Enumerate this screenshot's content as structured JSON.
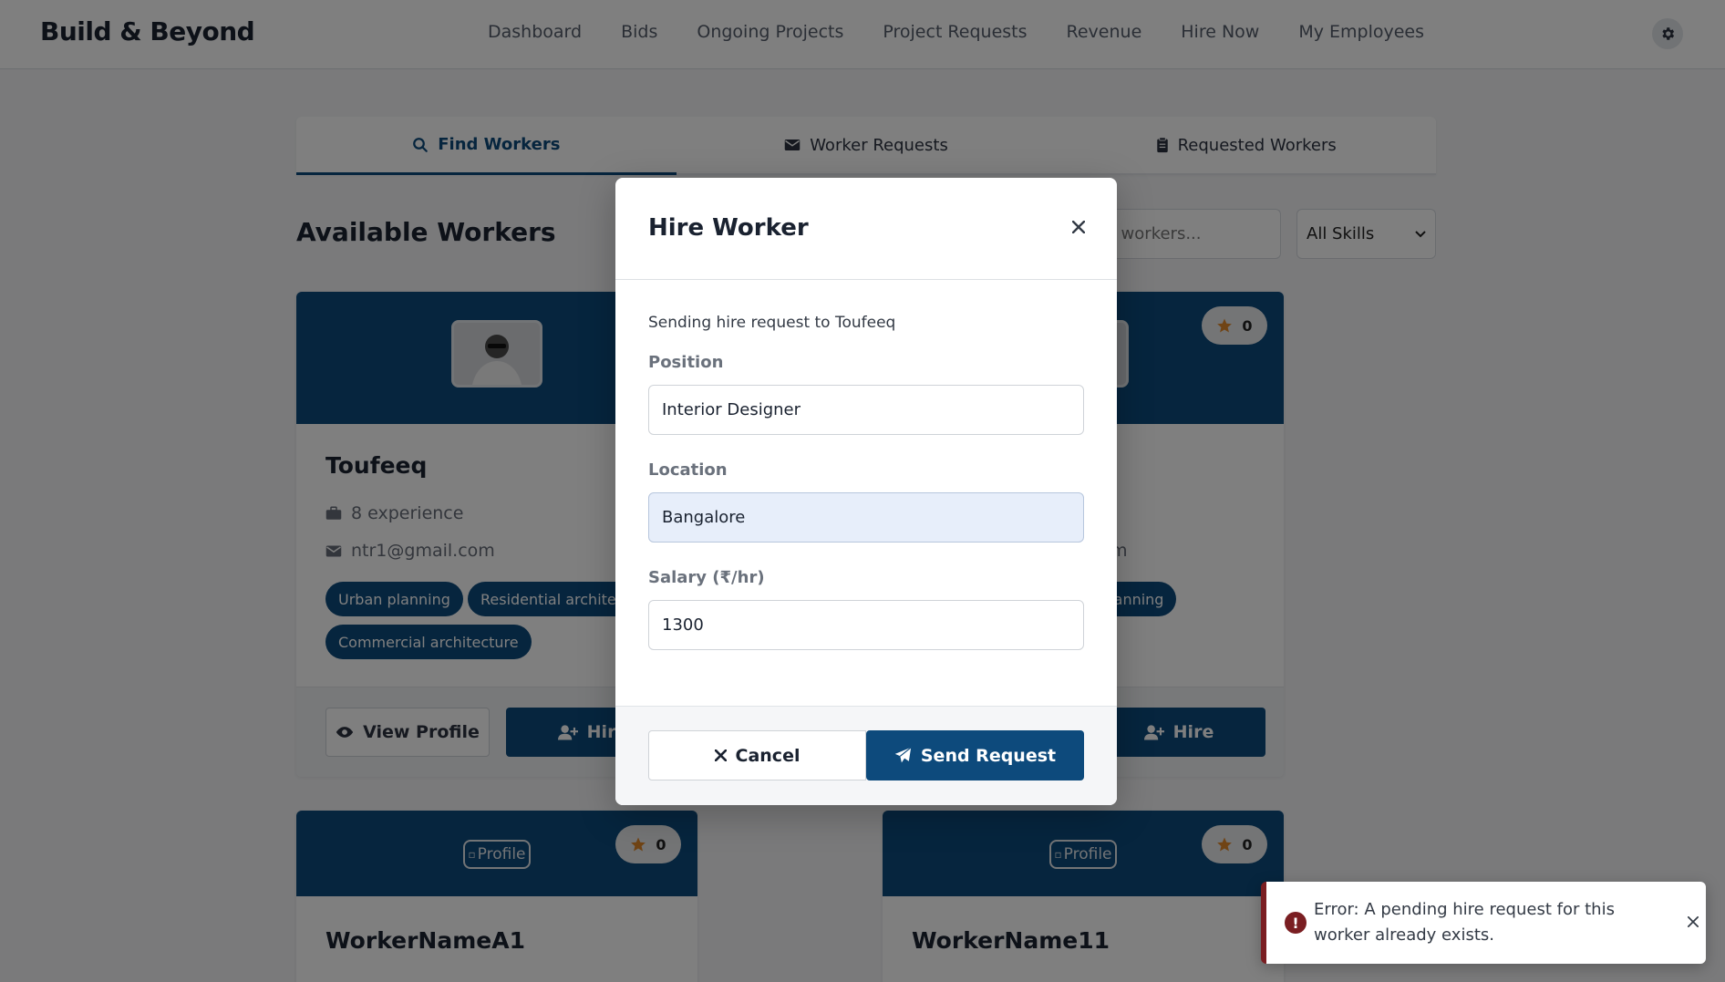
{
  "nav": {
    "brand": "Build & Beyond",
    "links": [
      "Dashboard",
      "Bids",
      "Ongoing Projects",
      "Project Requests",
      "Revenue",
      "Hire Now",
      "My Employees"
    ],
    "settings_icon": "gear-icon"
  },
  "tabs": [
    {
      "label": "Find Workers",
      "icon": "search-icon",
      "active": true
    },
    {
      "label": "Worker Requests",
      "icon": "envelope-icon",
      "active": false
    },
    {
      "label": "Requested Workers",
      "icon": "clipboard-icon",
      "active": false
    }
  ],
  "section": {
    "title": "Available Workers",
    "search_placeholder": "Search workers...",
    "skills_filter": "All Skills"
  },
  "cards": [
    {
      "name": "Toufeeq",
      "experience": "8 experience",
      "email": "ntr1@gmail.com",
      "skills": [
        "Urban planning",
        "Residential architecture",
        "Commercial architecture"
      ],
      "view_label": "View Profile",
      "hire_label": "Hire"
    },
    {
      "rating": "0",
      "email_tail": "m",
      "skill_tail": "an planning",
      "hire_label": "Hire"
    },
    {
      "name": "WorkerNameA1",
      "rating": "0",
      "img_alt": "Profile"
    },
    {
      "name": "WorkerName11",
      "rating": "0",
      "img_alt": "Profile"
    }
  ],
  "modal": {
    "title": "Hire Worker",
    "intro": "Sending hire request to Toufeeq",
    "position_label": "Position",
    "position_value": "Interior Designer",
    "location_label": "Location",
    "location_value": "Bangalore",
    "salary_label": "Salary (₹/hr)",
    "salary_value": "1300",
    "cancel_label": "Cancel",
    "send_label": "Send Request"
  },
  "toast": {
    "message": "Error: A pending hire request for this worker already exists."
  },
  "colors": {
    "primary": "#0d4a7c",
    "error": "#7a1e22",
    "star": "#e0892a"
  }
}
